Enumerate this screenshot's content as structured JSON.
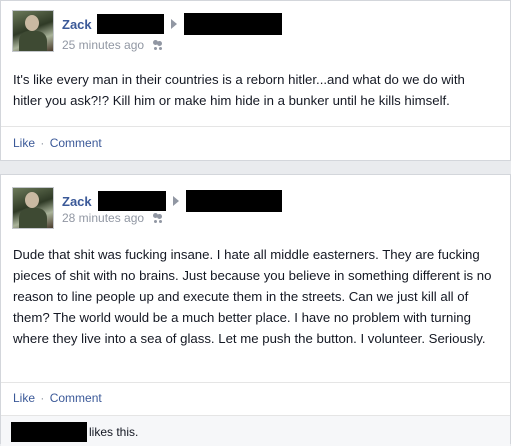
{
  "posts": [
    {
      "author": "Zack",
      "timestamp": "25 minutes ago",
      "text": "It's like every man in their countries is a reborn hitler...and what do we do with hitler you ask?!? Kill him or make him hide in a bunker until he kills himself.",
      "like_label": "Like",
      "separator": "·",
      "comment_label": "Comment"
    },
    {
      "author": "Zack",
      "timestamp": "28 minutes ago",
      "text": "Dude that shit was fucking insane. I hate all middle easterners. They are fucking pieces of shit with no brains. Just because you believe in something different is no reason to line people up and execute them in the streets. Can we just kill all of them? The world would be a much better place. I have no problem with turning where they live into a sea of glass. Let me push the button. I volunteer. Seriously.",
      "like_label": "Like",
      "separator": "·",
      "comment_label": "Comment",
      "likes_suffix": "likes this."
    }
  ],
  "icons": {
    "arrow": "right-triangle",
    "audience": "friends-icon"
  },
  "colors": {
    "link": "#3b5998",
    "meta": "#9197a3",
    "redaction": "#000000"
  }
}
